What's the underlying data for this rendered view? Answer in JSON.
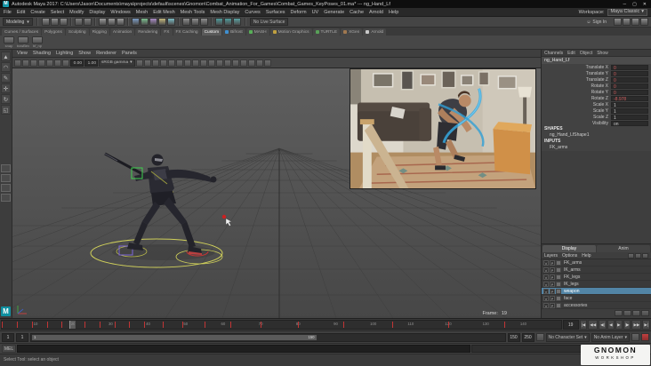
{
  "icons": {
    "chevron": "▾",
    "person": "☺"
  },
  "titlebar": {
    "title": "Autodesk Maya 2017: C:\\Users\\Jason\\Documents\\maya\\projects\\default\\scenes\\Gnomon\\Combat_Animation_For_Games\\Combat_Games_KeyPoses_01.ma* --- ng_Hand_Lf",
    "minimize": "─",
    "maximize": "▢",
    "close": "✕"
  },
  "menubar": {
    "items": [
      "File",
      "Edit",
      "Create",
      "Select",
      "Modify",
      "Display",
      "Windows",
      "Mesh",
      "Edit Mesh",
      "Mesh Tools",
      "Mesh Display",
      "Curves",
      "Surfaces",
      "Deform",
      "UV",
      "Generate",
      "Cache",
      "Arnold",
      "Help"
    ],
    "workspace_label": "Workspace:",
    "workspace_value": "Maya Classic"
  },
  "statusline": {
    "menuset": "Modeling",
    "no_live_surface": "No Live Surface",
    "sign_in": "Sign In",
    "groups": [
      {
        "icons": [
          {
            "n": "new-scene-icon",
            "c": "#8d8d8d"
          },
          {
            "n": "open-scene-icon",
            "c": "#8d8d8d"
          },
          {
            "n": "save-scene-icon",
            "c": "#8d8d8d"
          }
        ]
      },
      {
        "icons": [
          {
            "n": "undo-icon",
            "c": "#7f7f7f"
          },
          {
            "n": "redo-icon",
            "c": "#7f7f7f"
          }
        ]
      },
      {
        "icons": [
          {
            "n": "select-hierarchy-icon",
            "c": "#9a9a9a"
          },
          {
            "n": "select-object-icon",
            "c": "#9a9a9a"
          },
          {
            "n": "select-component-icon",
            "c": "#9a9a9a"
          }
        ]
      },
      {
        "icons": [
          {
            "n": "snap-to-grid-icon",
            "c": "#7b9cc4"
          },
          {
            "n": "snap-to-curve-icon",
            "c": "#7bbf8e"
          },
          {
            "n": "snap-to-point-icon",
            "c": "#a98bc4"
          },
          {
            "n": "snap-to-plane-icon",
            "c": "#c4b87b"
          },
          {
            "n": "make-live-icon",
            "c": "#7bbcc4"
          }
        ]
      },
      {
        "icons": [
          {
            "n": "input-connections-icon",
            "c": "#8d8d8d"
          },
          {
            "n": "output-connections-icon",
            "c": "#8d8d8d"
          },
          {
            "n": "construction-history-icon",
            "c": "#8d8d8d"
          }
        ]
      },
      {
        "icons": [
          {
            "n": "render-current-frame-icon",
            "c": "#4f9a9a"
          },
          {
            "n": "ipr-render-icon",
            "c": "#4f9a9a"
          },
          {
            "n": "render-settings-icon",
            "c": "#5aa0a0"
          }
        ]
      }
    ],
    "right_icons": [
      {
        "n": "modeling-toolkit-icon",
        "c": "#8d8d8d"
      },
      {
        "n": "attribute-editor-icon",
        "c": "#8d8d8d"
      },
      {
        "n": "tool-settings-icon",
        "c": "#8d8d8d"
      },
      {
        "n": "channel-box-icon",
        "c": "#8d8d8d"
      }
    ]
  },
  "shelf": {
    "tabs": [
      {
        "label": "Curves / Surfaces"
      },
      {
        "label": "Polygons"
      },
      {
        "label": "Sculpting"
      },
      {
        "label": "Rigging"
      },
      {
        "label": "Animation"
      },
      {
        "label": "Rendering"
      },
      {
        "label": "FX"
      },
      {
        "label": "FX Caching"
      },
      {
        "label": "Custom",
        "active": true
      },
      {
        "label": "Bifrost",
        "ico": "#3f8fd0"
      },
      {
        "label": "MASH",
        "ico": "#58b058"
      },
      {
        "label": "Motion Graphics",
        "ico": "#c0a040"
      },
      {
        "label": "TURTLE",
        "ico": "#58a058"
      },
      {
        "label": "XGen",
        "ico": "#a07850"
      },
      {
        "label": "Arnold",
        "ico": "#c8c8c8"
      }
    ],
    "items": [
      {
        "label": "snap"
      },
      {
        "label": "bowBev"
      },
      {
        "label": "bf_np"
      }
    ]
  },
  "toolbox": {
    "tools": [
      {
        "name": "select-tool-icon",
        "glyph": "▲"
      },
      {
        "name": "lasso-tool-icon",
        "glyph": "◠"
      },
      {
        "name": "paint-select-tool-icon",
        "glyph": "✎"
      },
      {
        "name": "move-tool-icon",
        "glyph": "✛"
      },
      {
        "name": "rotate-tool-icon",
        "glyph": "↻"
      },
      {
        "name": "scale-tool-icon",
        "glyph": "◱"
      }
    ],
    "layouts": [
      {
        "name": "layout-single-pane-button"
      },
      {
        "name": "layout-four-pane-button"
      },
      {
        "name": "layout-persp-outliner-button"
      },
      {
        "name": "layout-hypershade-button"
      }
    ]
  },
  "panel": {
    "menus": [
      "View",
      "Shading",
      "Lighting",
      "Show",
      "Renderer",
      "Panels"
    ],
    "left_icons": [
      "select-camera-icon",
      "lock-camera-icon",
      "camera-attributes-icon",
      "bookmarks-icon",
      "image-plane-icon",
      "2d-pan-zoom-icon",
      "grease-pencil-icon"
    ],
    "exposure": "0.00",
    "gamma": "1.00",
    "colorspace": "sRGB gamma",
    "right_icons": [
      "grid-icon",
      "film-gate-icon",
      "resolution-gate-icon",
      "gate-mask-icon",
      "field-chart-icon",
      "safe-action-icon",
      "safe-title-icon",
      "wireframe-icon",
      "shaded-icon",
      "textured-icon",
      "lights-icon",
      "shadows-icon",
      "screen-space-ao-icon",
      "motion-blur-icon",
      "multisample-icon",
      "xray-icon",
      "isolate-select-icon"
    ]
  },
  "viewport": {
    "frame_label": "Frame:",
    "frame_value": "19"
  },
  "channel_box": {
    "menus": [
      "Channels",
      "Edit",
      "Object",
      "Show"
    ],
    "object": "ng_Hand_Lf",
    "rows": [
      {
        "name": "Translate X",
        "value": "0",
        "keyed": true
      },
      {
        "name": "Translate Y",
        "value": "0",
        "keyed": true
      },
      {
        "name": "Translate Z",
        "value": "0",
        "keyed": true
      },
      {
        "name": "Rotate X",
        "value": "0",
        "keyed": true
      },
      {
        "name": "Rotate Y",
        "value": "0",
        "keyed": true
      },
      {
        "name": "Rotate Z",
        "value": "-8.978",
        "keyed": true
      },
      {
        "name": "Scale X",
        "value": "1"
      },
      {
        "name": "Scale Y",
        "value": "1"
      },
      {
        "name": "Scale Z",
        "value": "1"
      },
      {
        "name": "Visibility",
        "value": "on"
      }
    ],
    "shapes_label": "SHAPES",
    "shape": "ng_Hand_LfShape1",
    "inputs_label": "INPUTS",
    "input": "FK_arms"
  },
  "layer_editor": {
    "tabs": [
      {
        "label": "Display",
        "active": true
      },
      {
        "label": "Anim"
      }
    ],
    "menus": [
      "Layers",
      "Options",
      "Help"
    ],
    "columns": {
      "v": "V",
      "p": "P"
    },
    "layers": [
      {
        "name": "FK_arms"
      },
      {
        "name": "IK_arms"
      },
      {
        "name": "FK_legs"
      },
      {
        "name": "IK_legs"
      },
      {
        "name": "weapon",
        "selected": true
      },
      {
        "name": "face"
      },
      {
        "name": "accessories"
      }
    ]
  },
  "time_slider": {
    "start": 1,
    "end": 150,
    "labels": [
      10,
      20,
      30,
      40,
      50,
      60,
      70,
      80,
      90,
      100,
      110,
      120,
      130,
      140
    ],
    "keys": [
      1,
      5,
      9,
      13,
      17,
      19,
      23,
      27,
      31,
      35,
      39,
      44,
      49,
      55,
      62,
      70,
      80,
      92,
      105,
      120,
      135,
      150
    ],
    "current": 19,
    "current_field": "19",
    "playback": [
      {
        "name": "go-to-start-button",
        "glyph": "|◀"
      },
      {
        "name": "step-back-key-button",
        "glyph": "◀◀"
      },
      {
        "name": "step-back-frame-button",
        "glyph": "◀|"
      },
      {
        "name": "play-backwards-button",
        "glyph": "◀"
      },
      {
        "name": "play-forward-button",
        "glyph": "▶"
      },
      {
        "name": "step-forward-frame-button",
        "glyph": "|▶"
      },
      {
        "name": "step-forward-key-button",
        "glyph": "▶▶"
      },
      {
        "name": "go-to-end-button",
        "glyph": "▶|"
      }
    ]
  },
  "range_slider": {
    "anim_start": "1",
    "play_start": "1",
    "inner_start": "1",
    "inner_end": "150",
    "play_end": "150",
    "anim_end": "250",
    "character_set": "No Character Set",
    "anim_layer": "No Anim Layer"
  },
  "command_line": {
    "label": "MEL"
  },
  "help_line": {
    "text": "Select Tool: select an object"
  },
  "watermark": {
    "line1": "GNOMON",
    "line2": "WORKSHOP"
  }
}
